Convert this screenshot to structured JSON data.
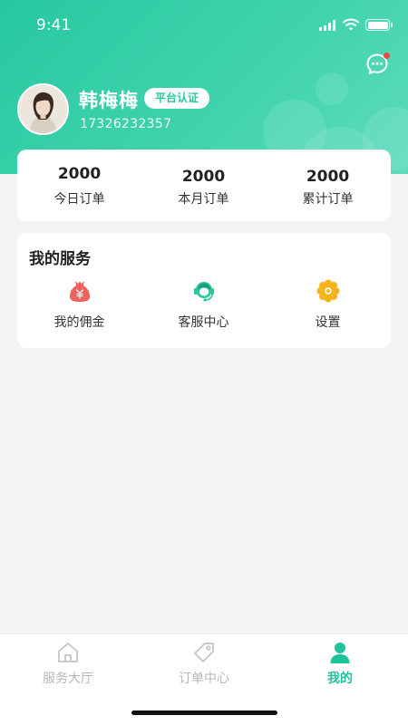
{
  "status_bar": {
    "time": "9:41"
  },
  "profile": {
    "name": "韩梅梅",
    "badge": "平台认证",
    "phone": "17326232357",
    "message_icon": "chat-bubble-icon",
    "has_unread": true
  },
  "stats": [
    {
      "value": "2000",
      "label": "今日订单"
    },
    {
      "value": "2000",
      "label": "本月订单"
    },
    {
      "value": "2000",
      "label": "累计订单"
    }
  ],
  "services": {
    "title": "我的服务",
    "items": [
      {
        "label": "我的佣金",
        "icon": "money-bag-icon"
      },
      {
        "label": "客服中心",
        "icon": "headset-icon"
      },
      {
        "label": "设置",
        "icon": "gear-icon"
      }
    ]
  },
  "tabbar": {
    "items": [
      {
        "label": "服务大厅",
        "icon": "home-icon",
        "active": false
      },
      {
        "label": "订单中心",
        "icon": "tag-icon",
        "active": false
      },
      {
        "label": "我的",
        "icon": "user-icon",
        "active": true
      }
    ]
  },
  "colors": {
    "brand": "#27c8a0",
    "active_tab": "#1fc39a",
    "badge_dot": "#f5483b"
  }
}
